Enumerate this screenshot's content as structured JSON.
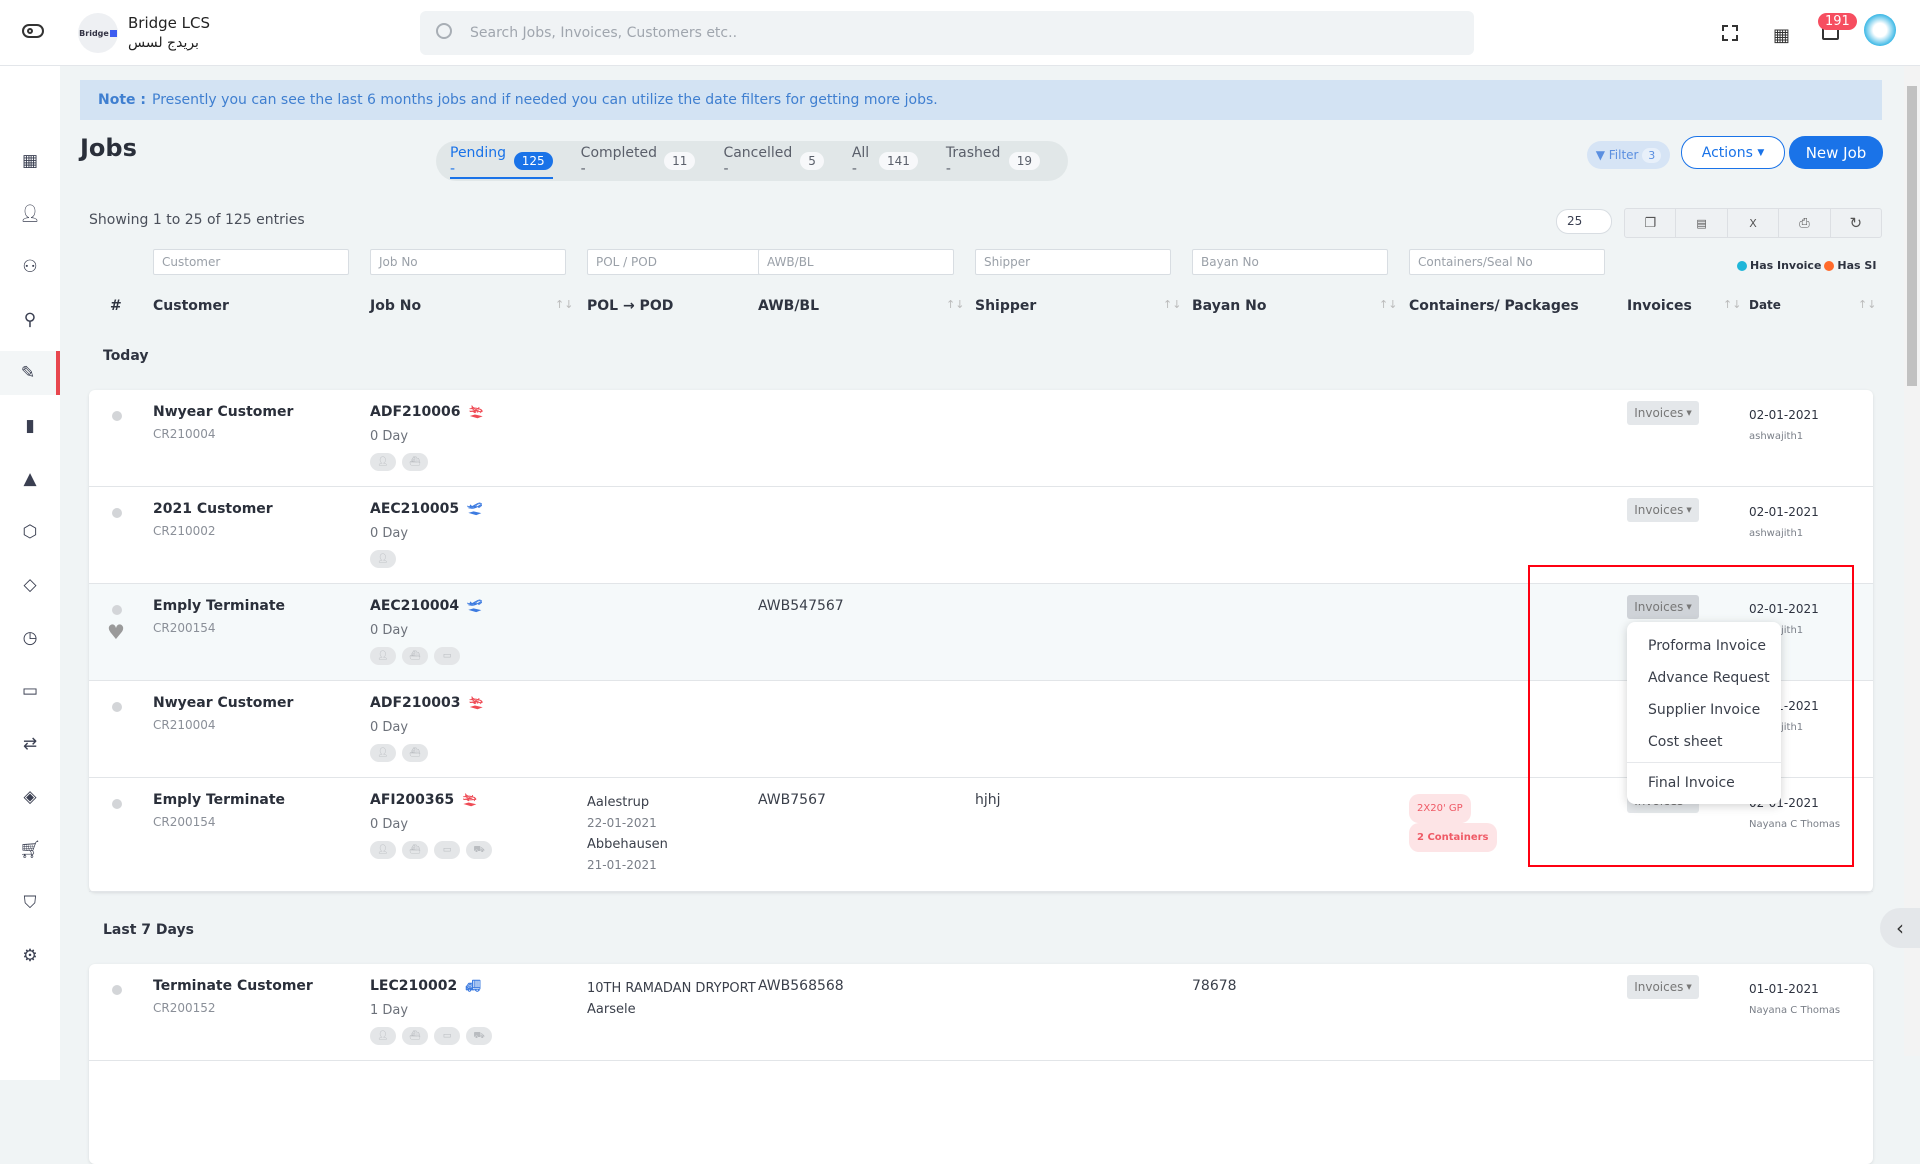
{
  "app": {
    "name": "Bridge LCS",
    "name_ar": "بريدج لسس",
    "logo_text": "Bridge",
    "notification_count": "191"
  },
  "search": {
    "placeholder": "Search Jobs, Invoices, Customers etc.."
  },
  "sidebar": {
    "items": [
      {
        "icon": "dashboard-icon"
      },
      {
        "icon": "user-icon"
      },
      {
        "icon": "users-icon"
      },
      {
        "icon": "user-plus-icon"
      },
      {
        "icon": "edit-icon",
        "active": true
      },
      {
        "icon": "bar-chart-icon"
      },
      {
        "icon": "navigation-icon"
      },
      {
        "icon": "box-icon"
      },
      {
        "icon": "tag-icon"
      },
      {
        "icon": "clock-icon"
      },
      {
        "icon": "credit-card-icon"
      },
      {
        "icon": "repeat-icon"
      },
      {
        "icon": "codepen-icon"
      },
      {
        "icon": "cart-icon"
      },
      {
        "icon": "shield-icon"
      },
      {
        "icon": "settings-icon"
      }
    ]
  },
  "note": {
    "label": "Note :",
    "text": "Presently you can see the last 6 months jobs and if needed you can utilize the date filters for getting more jobs."
  },
  "page": {
    "title": "Jobs"
  },
  "tabs": [
    {
      "label": "Pending -",
      "count": "125",
      "active": true
    },
    {
      "label": "Completed -",
      "count": "11"
    },
    {
      "label": "Cancelled -",
      "count": "5"
    },
    {
      "label": "All -",
      "count": "141"
    },
    {
      "label": "Trashed -",
      "count": "19"
    }
  ],
  "toolbar": {
    "filter_label": "Filter",
    "filter_count": "3",
    "actions_label": "Actions",
    "new_job_label": "New Job",
    "page_size": "25",
    "showing": "Showing 1 to 25 of 125 entries"
  },
  "legend": {
    "has_invoice": "Has Invoice",
    "has_si": "Has SI",
    "has_invoice_color": "#1fb6d9",
    "has_si_color": "#ff6a2b"
  },
  "filters": [
    "Customer",
    "Job No",
    "POL / POD",
    "AWB/BL",
    "Shipper",
    "Bayan No",
    "Containers/Seal No"
  ],
  "columns": {
    "num": "#",
    "customer": "Customer",
    "job": "Job No",
    "pol": "POL → POD",
    "awb": "AWB/BL",
    "shipper": "Shipper",
    "bayan": "Bayan No",
    "containers": "Containers/ Packages",
    "invoices": "Invoices",
    "date": "Date"
  },
  "sections": [
    {
      "title": "Today",
      "rows": [
        {
          "customer": "Nwyear Customer",
          "code": "CR210004",
          "job": "ADF210006",
          "mode": "plane-arrival",
          "mode_color": "#ef4b55",
          "day": "0 Day",
          "chips": 2,
          "invoice_label": "Invoices",
          "date": "02-01-2021",
          "user": "ashwajith1"
        },
        {
          "customer": "2021 Customer",
          "code": "CR210002",
          "job": "AEC210005",
          "mode": "plane-departure",
          "mode_color": "#3d7be0",
          "day": "0 Day",
          "chips": 1,
          "invoice_label": "Invoices",
          "date": "02-01-2021",
          "user": "ashwajith1"
        },
        {
          "customer": "Emply Terminate",
          "code": "CR200154",
          "job": "AEC210004",
          "mode": "plane-departure",
          "mode_color": "#3d7be0",
          "day": "0 Day",
          "chips": 3,
          "awb": "AWB547567",
          "invoice_label": "Invoices",
          "date": "02-01-2021",
          "user": "ashwajith1",
          "favorite": true,
          "highlight": true
        },
        {
          "customer": "Nwyear Customer",
          "code": "CR210004",
          "job": "ADF210003",
          "mode": "plane-arrival",
          "mode_color": "#ef4b55",
          "day": "0 Day",
          "chips": 2,
          "invoice_label": "Invoices",
          "date": "02-01-2021",
          "user": "ashwajith1"
        },
        {
          "customer": "Emply Terminate",
          "code": "CR200154",
          "job": "AFI200365",
          "mode": "plane-arrival",
          "mode_color": "#ef4b55",
          "day": "0 Day",
          "chips": 4,
          "pol": "Aalestrup",
          "pol_date": "22-01-2021",
          "pod": "Abbehausen",
          "pod_date": "21-01-2021",
          "awb": "AWB7567",
          "shipper": "hjhj",
          "container_type": "2X20' GP",
          "container_count": "2 Containers",
          "invoice_label": "Invoices",
          "date": "02-01-2021",
          "user": "Nayana C Thomas"
        }
      ]
    },
    {
      "title": "Last 7 Days",
      "rows": [
        {
          "customer": "Terminate Customer",
          "code": "CR200152",
          "job": "LEC210002",
          "mode": "truck",
          "mode_color": "#3d7be0",
          "day": "1 Day",
          "chips": 4,
          "pol": "10TH RAMADAN DRYPORT",
          "pod": "Aarsele",
          "awb": "AWB568568",
          "bayan": "78678",
          "invoice_label": "Invoices",
          "date": "01-01-2021",
          "user": "Nayana C Thomas"
        }
      ]
    }
  ],
  "invoice_menu": {
    "items": [
      "Proforma Invoice",
      "Advance Request",
      "Supplier Invoice",
      "Cost sheet"
    ],
    "final": "Final Invoice"
  },
  "colors": {
    "primary": "#1a73e8",
    "highlight_box": "#ff0011",
    "badge": "#f64e60"
  }
}
